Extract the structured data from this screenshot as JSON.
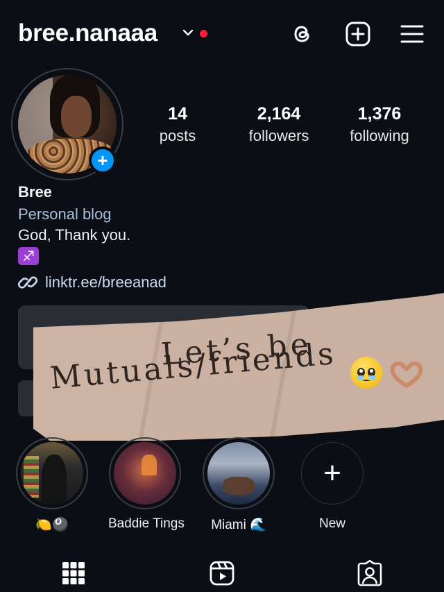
{
  "header": {
    "username": "bree.nanaaa",
    "icons": [
      "threads-icon",
      "create-post-icon",
      "menu-icon"
    ],
    "notification_color": "#ff1f3d"
  },
  "profile": {
    "stats": [
      {
        "value": "14",
        "label": "posts"
      },
      {
        "value": "2,164",
        "label": "followers"
      },
      {
        "value": "1,376",
        "label": "following"
      }
    ],
    "name": "Bree",
    "category": "Personal blog",
    "bio": "God, Thank you.",
    "zodiac_glyph": "♐",
    "link": "linktr.ee/breeanad"
  },
  "banner": {
    "line1": "Let’s be",
    "line2": "Mutuals/friends"
  },
  "highlights": [
    {
      "label": "🍋🎱"
    },
    {
      "label": "Baddie Tings"
    },
    {
      "label": "Miami 🌊"
    },
    {
      "label": "New",
      "glyph": "+"
    }
  ],
  "tabs": [
    "grid-icon",
    "reels-icon",
    "tagged-icon"
  ],
  "colors": {
    "background": "#0b0e14",
    "accent": "#0095f6",
    "link": "#c9dcf0",
    "category": "#a6c1dd"
  }
}
